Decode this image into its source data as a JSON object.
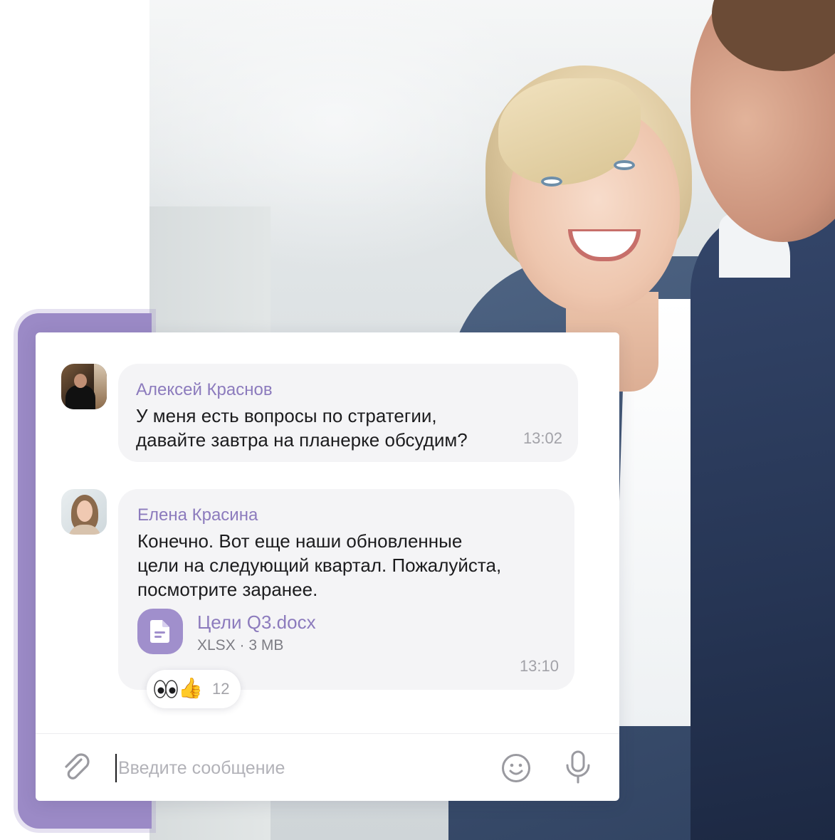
{
  "chat": {
    "messages": [
      {
        "sender": "Алексей Краснов",
        "text": "У меня есть вопросы по стратегии,\nдавайте завтра на планерке обсудим?",
        "time": "13:02",
        "avatar_icon": "user-avatar-photo"
      },
      {
        "sender": "Елена Красина",
        "text": "Конечно. Вот еще наши обновленные\nцели на следующий квартал. Пожалуйста,\nпосмотрите заранее.",
        "time": "13:10",
        "avatar_icon": "user-avatar-photo",
        "attachment": {
          "name": "Цели Q3.docx",
          "meta": "XLSX · 3 MB",
          "icon": "document-icon"
        },
        "reactions": {
          "emojis": [
            "eyes-icon",
            "thumbs-up-icon"
          ],
          "count": "12"
        }
      }
    ]
  },
  "composer": {
    "placeholder": "Введите сообщение",
    "value": "",
    "attach_icon": "paperclip-icon",
    "emoji_icon": "smiley-icon",
    "mic_icon": "microphone-icon"
  },
  "colors": {
    "accent": "#8c7bbd",
    "accent_fill": "#a08fcc",
    "backdrop": "#9b8ac6",
    "bubble": "#f4f4f6",
    "text": "#1c1c1e",
    "muted": "#a2a2a8"
  },
  "background": {
    "image": "photo-business-meeting"
  }
}
